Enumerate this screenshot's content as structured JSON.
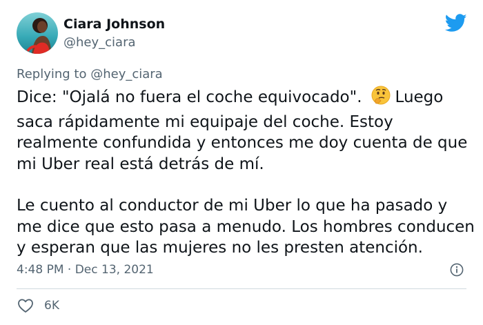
{
  "author": {
    "name": "Ciara Johnson",
    "handle": "@hey_ciara",
    "avatar_icon": "profile-photo"
  },
  "reply": {
    "prefix": "Replying to",
    "mention": "@hey_ciara"
  },
  "tweet": {
    "paragraph1": {
      "line1_before_emoji": "Dice: \"Ojalá no fuera el coche equivocado\".",
      "emoji": "thinking-face-emoji",
      "line1_after_emoji": "Luego",
      "line2": "saca rápidamente mi equipaje del coche. Estoy",
      "line3": "realmente confundida y entonces me doy cuenta de que",
      "line4": "mi Uber real está detrás de mí."
    },
    "paragraph2": {
      "line1": "Le cuento al conductor de mi Uber lo que ha pasado y",
      "line2": "me dice que esto pasa a menudo. Los hombres conducen",
      "line3": "y esperan que las mujeres no les presten atención."
    }
  },
  "meta": {
    "timestamp": "4:48 PM · Dec 13, 2021"
  },
  "actions": {
    "like_count": "6K"
  },
  "colors": {
    "text": "#0f1419",
    "secondary": "#536471",
    "twitter_blue": "#1d9bf0",
    "divider": "#cfd9de"
  }
}
